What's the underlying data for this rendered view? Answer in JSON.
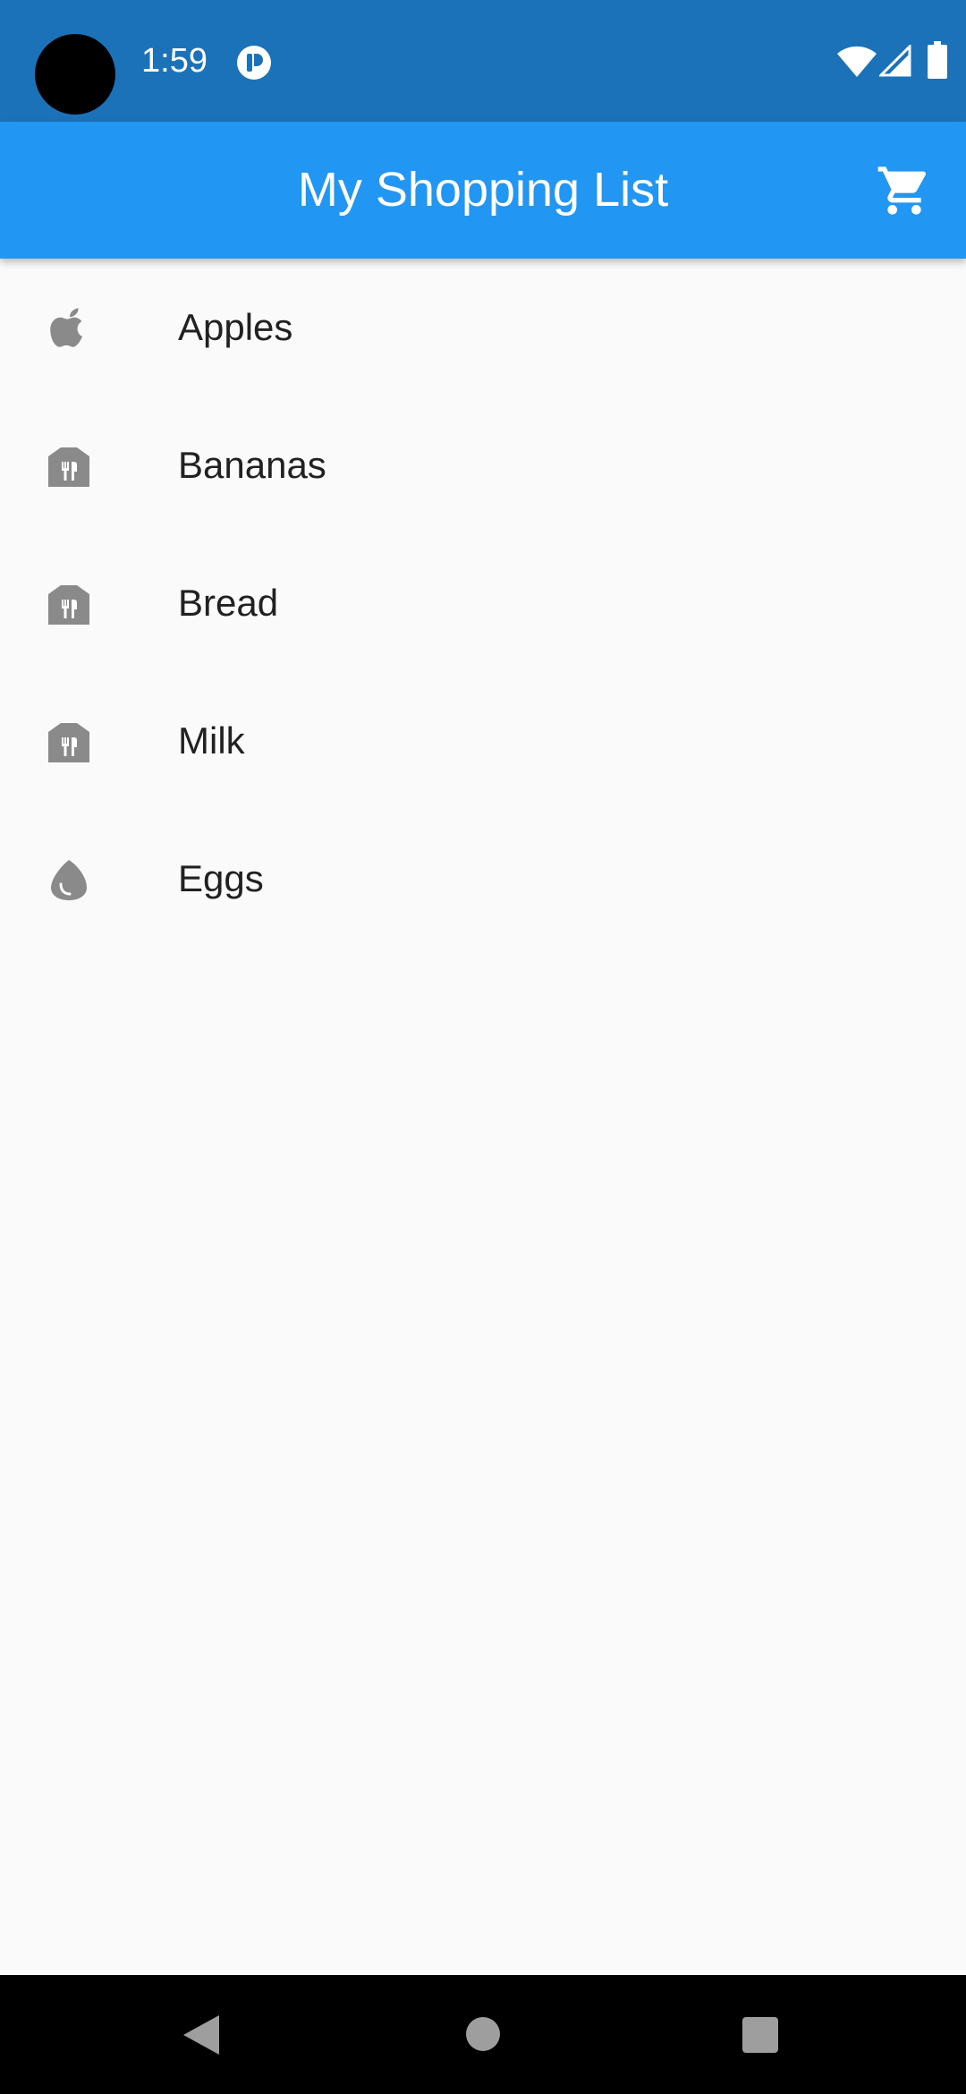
{
  "status_bar": {
    "time": "1:59",
    "icons": [
      "camera-cutout",
      "notification-icon",
      "wifi-icon",
      "signal-icon",
      "battery-icon"
    ]
  },
  "app_bar": {
    "title": "My Shopping List",
    "action_icon": "shopping-cart-icon",
    "background": "#2196f3"
  },
  "items": [
    {
      "label": "Apples",
      "icon": "apple-icon"
    },
    {
      "label": "Bananas",
      "icon": "grocery-store-icon"
    },
    {
      "label": "Bread",
      "icon": "grocery-store-icon"
    },
    {
      "label": "Milk",
      "icon": "grocery-store-icon"
    },
    {
      "label": "Eggs",
      "icon": "egg-icon"
    }
  ],
  "nav_bar": {
    "buttons": [
      "back-icon",
      "home-icon",
      "recents-icon"
    ]
  },
  "colors": {
    "status_bar": "#1b72b8",
    "icon_gray": "#8a8a8a",
    "text": "#212121"
  }
}
